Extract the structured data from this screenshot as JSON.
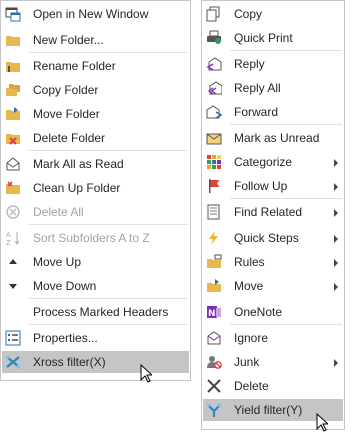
{
  "left_menu": {
    "items": [
      {
        "label": "Open in New Window",
        "icon": "open-window-icon",
        "disabled": false
      },
      {
        "label": "New Folder...",
        "icon": "new-folder-icon",
        "disabled": false
      },
      {
        "label": "Rename Folder",
        "icon": "rename-folder-icon",
        "disabled": false
      },
      {
        "label": "Copy Folder",
        "icon": "copy-folder-icon",
        "disabled": false
      },
      {
        "label": "Move Folder",
        "icon": "move-folder-icon",
        "disabled": false
      },
      {
        "label": "Delete Folder",
        "icon": "delete-folder-icon",
        "disabled": false
      },
      {
        "label": "Mark All as Read",
        "icon": "mark-read-envelope-icon",
        "disabled": false
      },
      {
        "label": "Clean Up Folder",
        "icon": "clean-up-folder-icon",
        "disabled": false
      },
      {
        "label": "Delete All",
        "icon": "delete-all-icon",
        "disabled": true
      },
      {
        "label": "Sort Subfolders A to Z",
        "icon": "sort-az-icon",
        "disabled": true
      },
      {
        "label": "Move Up",
        "icon": "triangle-up-icon",
        "disabled": false
      },
      {
        "label": "Move Down",
        "icon": "triangle-down-icon",
        "disabled": false
      },
      {
        "label": "Process Marked Headers",
        "icon": "",
        "disabled": false
      },
      {
        "label": "Properties...",
        "icon": "properties-icon",
        "disabled": false
      },
      {
        "label": "Xross filter(X)",
        "icon": "xross-filter-icon",
        "disabled": false,
        "hovered": true
      }
    ]
  },
  "right_menu": {
    "items": [
      {
        "label": "Copy",
        "icon": "copy-icon",
        "submenu": false
      },
      {
        "label": "Quick Print",
        "icon": "printer-icon",
        "submenu": false
      },
      {
        "label": "Reply",
        "icon": "reply-icon",
        "submenu": false
      },
      {
        "label": "Reply All",
        "icon": "reply-all-icon",
        "submenu": false
      },
      {
        "label": "Forward",
        "icon": "forward-icon",
        "submenu": false
      },
      {
        "label": "Mark as Unread",
        "icon": "mark-unread-icon",
        "submenu": false
      },
      {
        "label": "Categorize",
        "icon": "categorize-icon",
        "submenu": true
      },
      {
        "label": "Follow Up",
        "icon": "flag-icon",
        "submenu": true
      },
      {
        "label": "Find Related",
        "icon": "find-related-icon",
        "submenu": true
      },
      {
        "label": "Quick Steps",
        "icon": "lightning-icon",
        "submenu": true
      },
      {
        "label": "Rules",
        "icon": "rules-icon",
        "submenu": true
      },
      {
        "label": "Move",
        "icon": "move-icon",
        "submenu": true
      },
      {
        "label": "OneNote",
        "icon": "onenote-icon",
        "submenu": false
      },
      {
        "label": "Ignore",
        "icon": "ignore-icon",
        "submenu": false
      },
      {
        "label": "Junk",
        "icon": "junk-icon",
        "submenu": true
      },
      {
        "label": "Delete",
        "icon": "delete-x-icon",
        "submenu": false
      },
      {
        "label": "Yield filter(Y)",
        "icon": "yield-filter-icon",
        "submenu": false,
        "hovered": true
      }
    ]
  },
  "colors": {
    "folder": "#e8b74e",
    "blue": "#2e6db4",
    "red": "#d9443a",
    "hover": "#c5c5c5",
    "disabled_text": "#a3a3a3"
  }
}
